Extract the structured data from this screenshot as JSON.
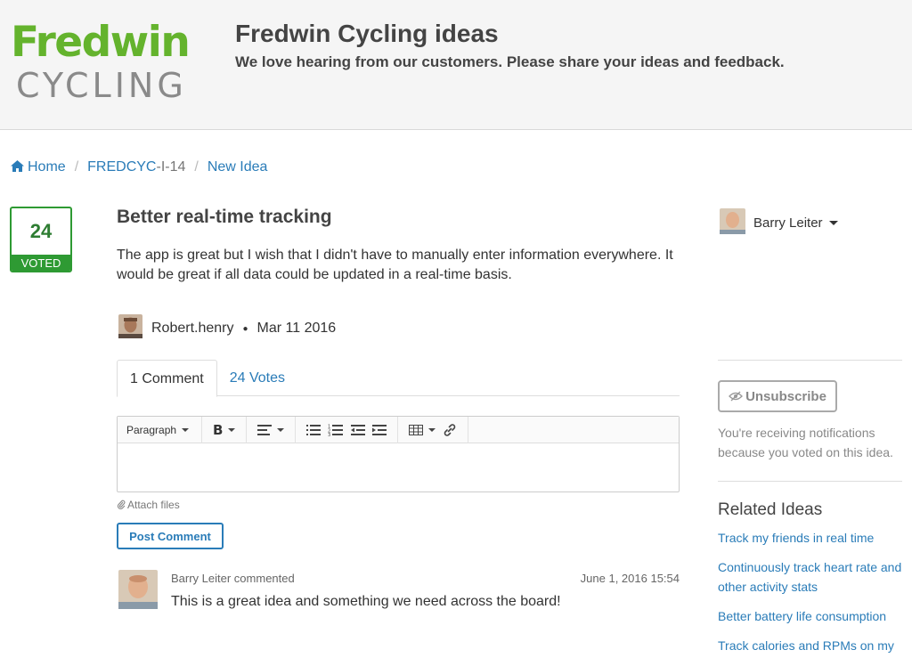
{
  "header": {
    "logo_top": "Fredwin",
    "logo_bottom": "CYCLING",
    "title": "Fredwin Cycling ideas",
    "subtitle": "We love hearing from our customers. Please share your ideas and feedback."
  },
  "breadcrumb": {
    "home": "Home",
    "idea_key_prefix": "FREDCYC",
    "idea_key_suffix": "-I-14",
    "status": "New Idea"
  },
  "vote": {
    "count": "24",
    "label": "VOTED"
  },
  "idea": {
    "title": "Better real-time tracking",
    "body": "The app is great but I wish that I didn't have to manually enter information everywhere. It would be great if all data could be updated in a real-time basis.",
    "author": "Robert.henry",
    "date": "Mar 11 2016"
  },
  "tabs": {
    "comments": "1 Comment",
    "votes": "24 Votes"
  },
  "editor": {
    "format": "Paragraph"
  },
  "attach_label": "Attach files",
  "post_label": "Post Comment",
  "comment": {
    "meta": "Barry Leiter commented",
    "date": "June 1, 2016 15:54",
    "text": "This is a great idea and something we need across the board!"
  },
  "sidebar": {
    "user": "Barry Leiter",
    "unsubscribe": "Unsubscribe",
    "notify": "You're receiving notifications because you voted on this idea.",
    "related_title": "Related Ideas",
    "related": [
      "Track my friends in real time",
      "Continuously track heart rate and other activity stats",
      "Better battery life consumption",
      "Track calories and RPMs on my"
    ]
  },
  "colors": {
    "brand_green": "#64b32d",
    "vote_green": "#2e9a33",
    "link_blue": "#2a7cb8"
  }
}
